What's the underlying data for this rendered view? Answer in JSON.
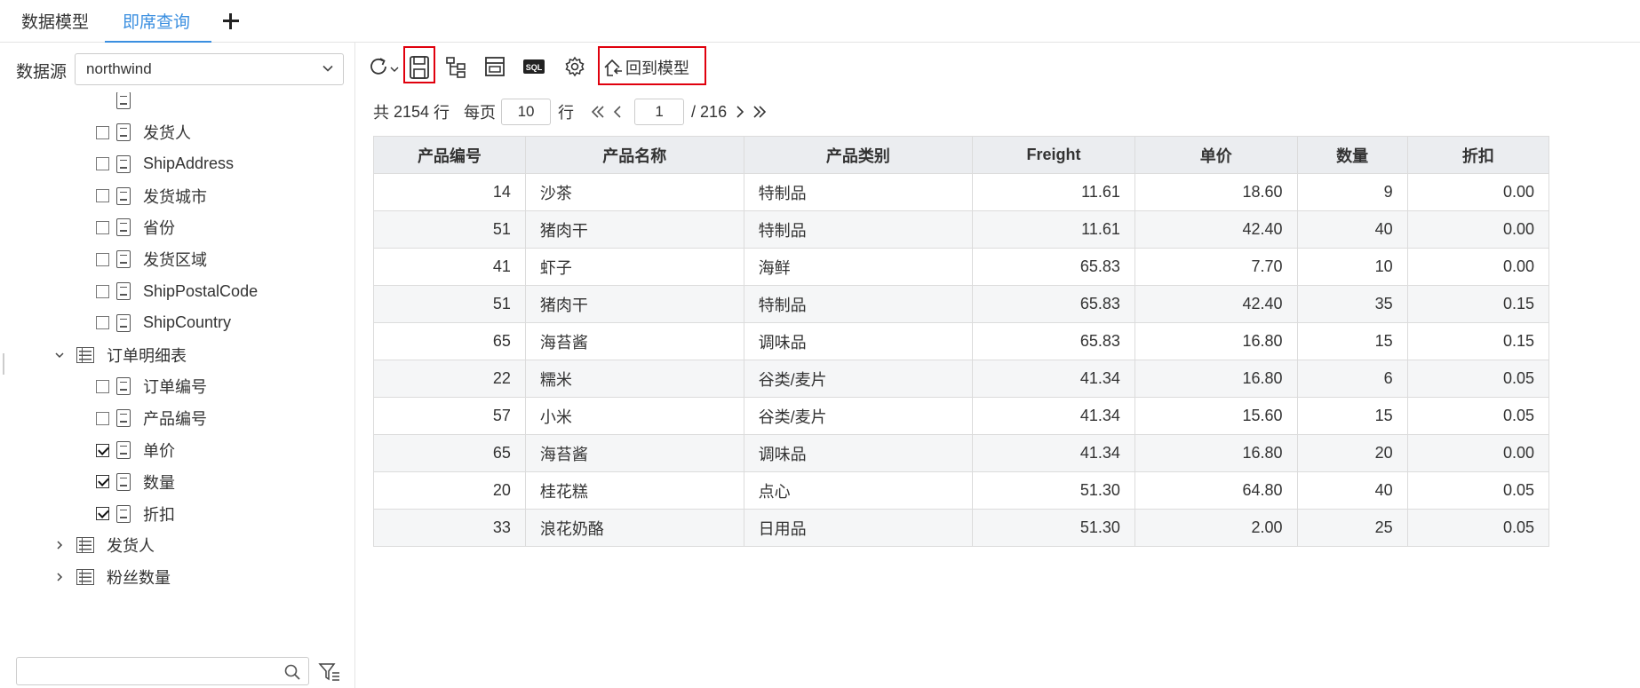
{
  "tabs": {
    "model": "数据模型",
    "adhoc": "即席查询"
  },
  "datasource": {
    "label": "数据源",
    "value": "northwind"
  },
  "tree": [
    {
      "kind": "field",
      "label": "发货人",
      "checked": false
    },
    {
      "kind": "field",
      "label": "ShipAddress",
      "checked": false
    },
    {
      "kind": "field",
      "label": "发货城市",
      "checked": false
    },
    {
      "kind": "field",
      "label": "省份",
      "checked": false
    },
    {
      "kind": "field",
      "label": "发货区域",
      "checked": false
    },
    {
      "kind": "field",
      "label": "ShipPostalCode",
      "checked": false
    },
    {
      "kind": "field",
      "label": "ShipCountry",
      "checked": false
    },
    {
      "kind": "table",
      "label": "订单明细表",
      "expanded": true
    },
    {
      "kind": "field",
      "label": "订单编号",
      "checked": false
    },
    {
      "kind": "field",
      "label": "产品编号",
      "checked": false
    },
    {
      "kind": "field",
      "label": "单价",
      "checked": true
    },
    {
      "kind": "field",
      "label": "数量",
      "checked": true
    },
    {
      "kind": "field",
      "label": "折扣",
      "checked": true
    },
    {
      "kind": "table",
      "label": "发货人",
      "expanded": false
    },
    {
      "kind": "table",
      "label": "粉丝数量",
      "expanded": false
    }
  ],
  "toolbar": {
    "back_label": "回到模型",
    "sql_label": "SQL"
  },
  "pager": {
    "total_prefix": "共",
    "total": "2154",
    "total_suffix": "行",
    "per_page_label": "每页",
    "per_page": "10",
    "rows_suffix": "行",
    "page": "1",
    "page_total": "/ 216"
  },
  "table": {
    "headers": [
      "产品编号",
      "产品名称",
      "产品类别",
      "Freight",
      "单价",
      "数量",
      "折扣"
    ],
    "rows": [
      [
        "14",
        "沙茶",
        "特制品",
        "11.61",
        "18.60",
        "9",
        "0.00"
      ],
      [
        "51",
        "猪肉干",
        "特制品",
        "11.61",
        "42.40",
        "40",
        "0.00"
      ],
      [
        "41",
        "虾子",
        "海鲜",
        "65.83",
        "7.70",
        "10",
        "0.00"
      ],
      [
        "51",
        "猪肉干",
        "特制品",
        "65.83",
        "42.40",
        "35",
        "0.15"
      ],
      [
        "65",
        "海苔酱",
        "调味品",
        "65.83",
        "16.80",
        "15",
        "0.15"
      ],
      [
        "22",
        "糯米",
        "谷类/麦片",
        "41.34",
        "16.80",
        "6",
        "0.05"
      ],
      [
        "57",
        "小米",
        "谷类/麦片",
        "41.34",
        "15.60",
        "15",
        "0.05"
      ],
      [
        "65",
        "海苔酱",
        "调味品",
        "41.34",
        "16.80",
        "20",
        "0.00"
      ],
      [
        "20",
        "桂花糕",
        "点心",
        "51.30",
        "64.80",
        "40",
        "0.05"
      ],
      [
        "33",
        "浪花奶酪",
        "日用品",
        "51.30",
        "2.00",
        "25",
        "0.05"
      ]
    ]
  },
  "colors": {
    "accent": "#3b8fe0",
    "highlight": "#e0000d",
    "header_bg": "#ebedf0"
  }
}
